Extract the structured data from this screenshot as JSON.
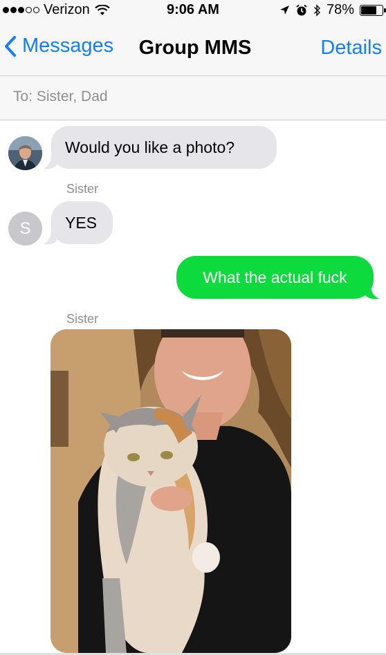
{
  "status_bar": {
    "carrier": "Verizon",
    "time": "9:06 AM",
    "battery": "78%",
    "battery_level": 0.78,
    "icons": [
      "signal-dots-icon",
      "wifi-icon",
      "location-icon",
      "alarm-icon",
      "bluetooth-icon",
      "battery-icon"
    ]
  },
  "nav": {
    "back_label": "Messages",
    "title": "Group MMS",
    "details_label": "Details"
  },
  "recipients": {
    "to_text": "To: Sister, Dad"
  },
  "messages": [
    {
      "sender": "",
      "text": "Would you like a photo?",
      "direction": "incoming"
    },
    {
      "sender": "Sister",
      "text": "YES",
      "direction": "incoming",
      "avatar_initial": "S"
    },
    {
      "sender": "",
      "text": "What the actual fuck",
      "direction": "outgoing"
    },
    {
      "sender": "Sister",
      "text": "",
      "direction": "incoming",
      "type": "photo"
    }
  ],
  "colors": {
    "accent": "#157efb",
    "incoming_bubble": "#e5e5ea",
    "outgoing_bubble": "#0ddb3d",
    "secondary_text": "#8e8e93"
  }
}
